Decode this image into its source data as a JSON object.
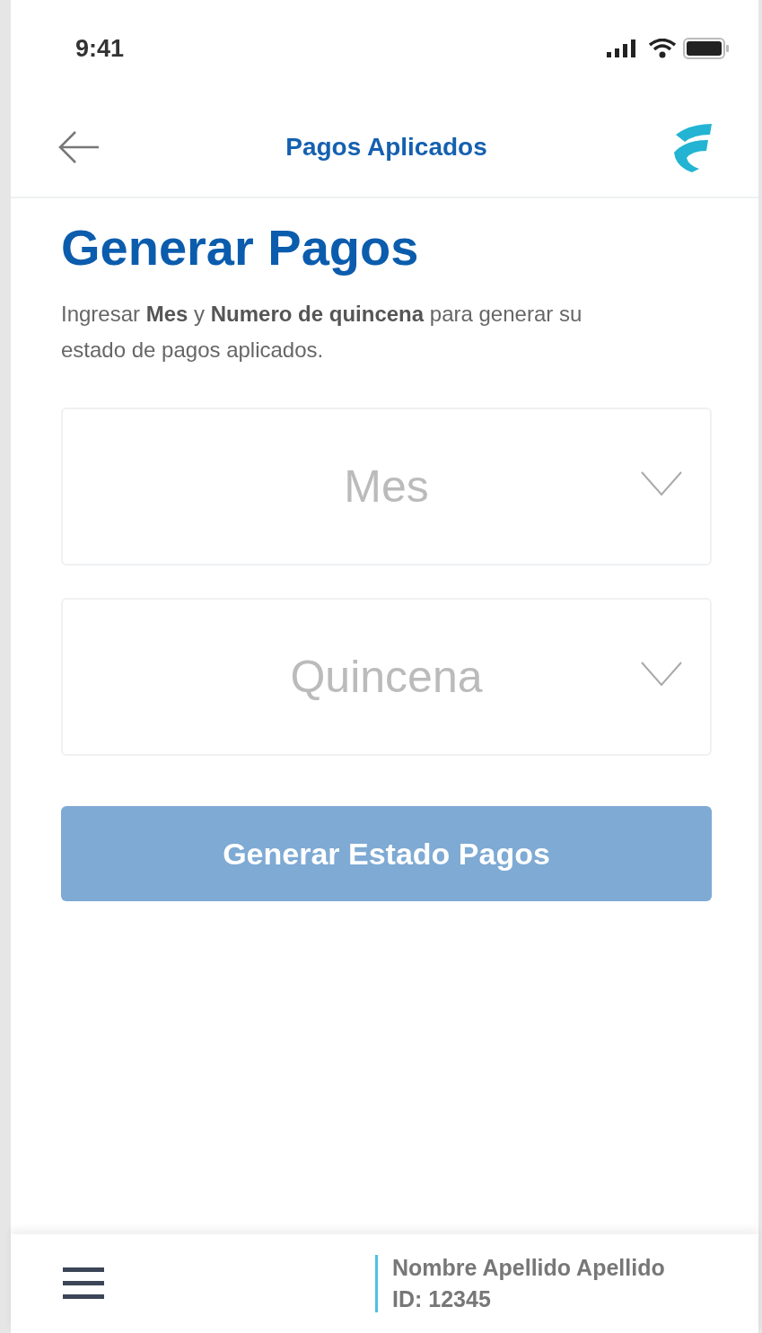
{
  "status_bar": {
    "time": "9:41"
  },
  "header": {
    "title": "Pagos Aplicados"
  },
  "page": {
    "heading": "Generar Pagos",
    "description": "Ingresar **Mes** y **Numero de quincena** para generar su estado de pagos aplicados."
  },
  "fields": [
    {
      "placeholder": "Mes"
    },
    {
      "placeholder": "Quincena"
    }
  ],
  "submit": {
    "label": "Generar Estado Pagos",
    "disabled": true
  },
  "footer": {
    "name": "Nombre Apellido Apellido",
    "id": "ID: 12345"
  }
}
